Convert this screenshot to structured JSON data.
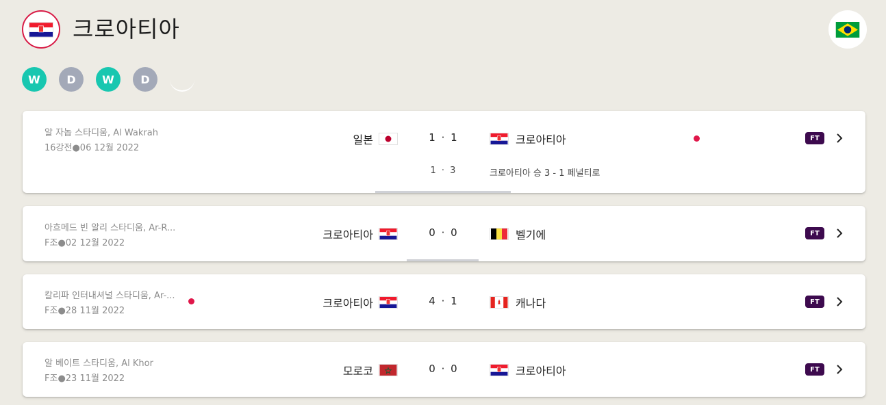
{
  "team": {
    "name": "크로아티아",
    "flag": "croatia-flag",
    "opponent_flag": "brazil-flag"
  },
  "form": [
    "W",
    "D",
    "W",
    "D"
  ],
  "matches": [
    {
      "venue": "알 자놉 스타디움, Al Wakrah",
      "info": "16강전●06 12월 2022",
      "home": "일본",
      "home_flag": "japan-flag",
      "away": "크로아티아",
      "away_flag": "croatia-flag",
      "score": "1 · 1",
      "status": "FT",
      "penalty_score": "1 · 3",
      "note": "크로아티아 승 3 - 1 페널티로"
    },
    {
      "venue": "아흐메드 빈 알리 스타디움, Ar-R...",
      "info": "F조●02 12월 2022",
      "home": "크로아티아",
      "home_flag": "croatia-flag",
      "away": "벨기에",
      "away_flag": "belgium-flag",
      "score": "0 · 0",
      "status": "FT"
    },
    {
      "venue": "칼리파 인터내셔널 스타디움, Ar-...",
      "info": "F조●28 11월 2022",
      "home": "크로아티아",
      "home_flag": "croatia-flag",
      "away": "캐나다",
      "away_flag": "canada-flag",
      "score": "4 · 1",
      "status": "FT"
    },
    {
      "venue": "알 베이트 스타디움, Al Khor",
      "info": "F조●23 11월 2022",
      "home": "모로코",
      "home_flag": "morocco-flag",
      "away": "크로아티아",
      "away_flag": "croatia-flag",
      "score": "0 · 0",
      "status": "FT"
    }
  ],
  "colors": {
    "win": "#18c7b0",
    "draw": "#a3a9b8",
    "accent": "#d81b46",
    "ft_badge": "#3d0a4e"
  }
}
